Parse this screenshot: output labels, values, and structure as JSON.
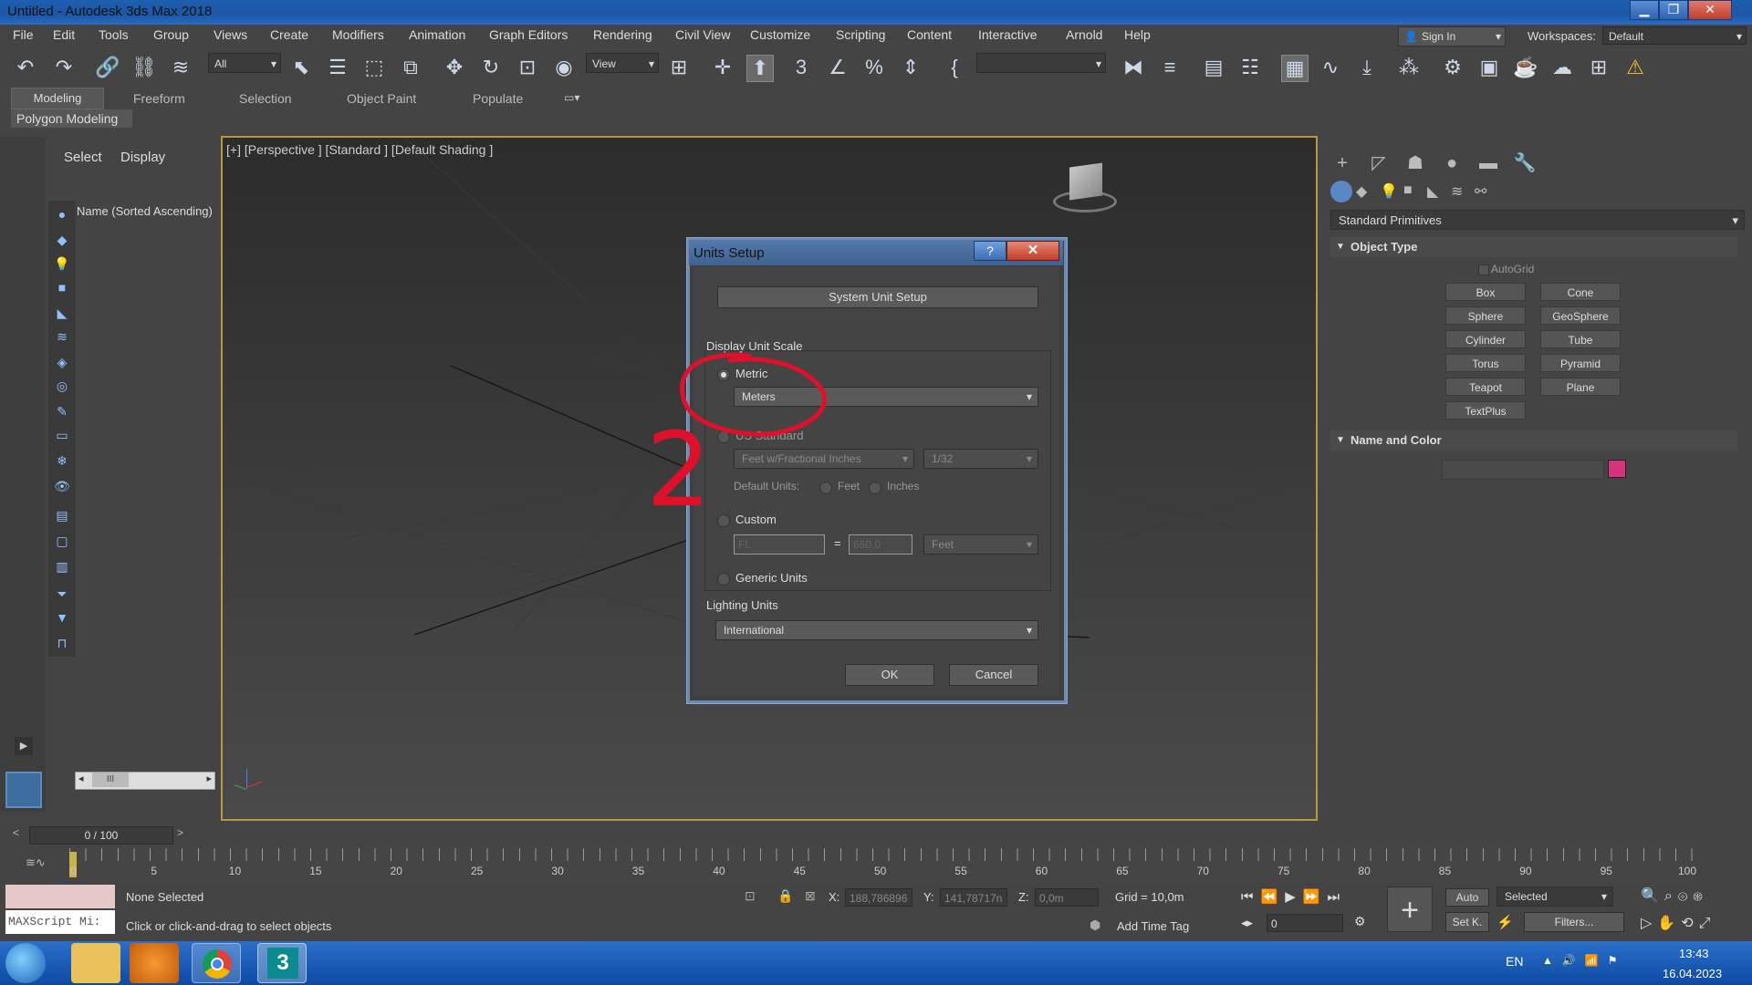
{
  "window": {
    "title": "Untitled - Autodesk 3ds Max 2018",
    "min": "▁",
    "max": "❐",
    "close": "✕"
  },
  "menu": [
    "File",
    "Edit",
    "Tools",
    "Group",
    "Views",
    "Create",
    "Modifiers",
    "Animation",
    "Graph Editors",
    "Rendering",
    "Civil View",
    "Customize",
    "Scripting",
    "Content",
    "Interactive",
    "Arnold",
    "Help"
  ],
  "account": {
    "sign_in": "Sign In",
    "workspaces_label": "Workspaces:",
    "workspace": "Default"
  },
  "toolbar": {
    "filter": "All",
    "reference": "View",
    "snaps_3": "3"
  },
  "ribbon": {
    "tabs": [
      "Modeling",
      "Freeform",
      "Selection",
      "Object Paint",
      "Populate"
    ],
    "sub": "Polygon Modeling"
  },
  "scene_explorer": {
    "tab_select": "Select",
    "tab_display": "Display",
    "column": "Name (Sorted Ascending)",
    "scroll": "III"
  },
  "viewport": {
    "label": "[+] [Perspective ] [Standard ] [Default Shading ]"
  },
  "command_panel": {
    "category": "Standard Primitives",
    "object_type": "Object Type",
    "autogrid": "AutoGrid",
    "primitives": [
      "Box",
      "Cone",
      "Sphere",
      "GeoSphere",
      "Cylinder",
      "Tube",
      "Torus",
      "Pyramid",
      "Teapot",
      "Plane",
      "TextPlus"
    ],
    "name_color": "Name and Color",
    "swatch_color": "#d6337a"
  },
  "dialog": {
    "title": "Units Setup",
    "help": "?",
    "close": "✕",
    "system_unit_setup": "System Unit Setup",
    "display_unit_scale": "Display Unit Scale",
    "metric": "Metric",
    "metric_unit": "Meters",
    "us_standard": "US Standard",
    "us_unit": "Feet w/Fractional Inches",
    "us_fraction": "1/32",
    "default_units": "Default Units:",
    "feet": "Feet",
    "inches": "Inches",
    "custom": "Custom",
    "custom_name": "FL",
    "custom_eq": "=",
    "custom_value": "660,0",
    "custom_unit": "Feet",
    "generic": "Generic Units",
    "lighting_units": "Lighting Units",
    "lighting_value": "International",
    "ok": "OK",
    "cancel": "Cancel",
    "annotation": "2"
  },
  "timeline": {
    "value": "0 / 100",
    "ticks": [
      "0",
      "5",
      "10",
      "15",
      "20",
      "25",
      "30",
      "35",
      "40",
      "45",
      "50",
      "55",
      "60",
      "65",
      "70",
      "75",
      "80",
      "85",
      "90",
      "95",
      "100"
    ]
  },
  "status": {
    "maxscript": "MAXScript Mi:",
    "selection": "None Selected",
    "prompt": "Click or click-and-drag to select objects",
    "x_label": "X:",
    "x": "188,786896",
    "y_label": "Y:",
    "y": "141,78717n",
    "z_label": "Z:",
    "z": "0,0m",
    "grid": "Grid = 10,0m",
    "add_time_tag": "Add Time Tag",
    "auto": "Auto",
    "selected": "Selected",
    "setk": "Set K.",
    "filters": "Filters...",
    "frame": "0"
  },
  "taskbar": {
    "lang": "EN",
    "time": "13:43",
    "date": "16.04.2023",
    "app_3ds_label": "3"
  }
}
